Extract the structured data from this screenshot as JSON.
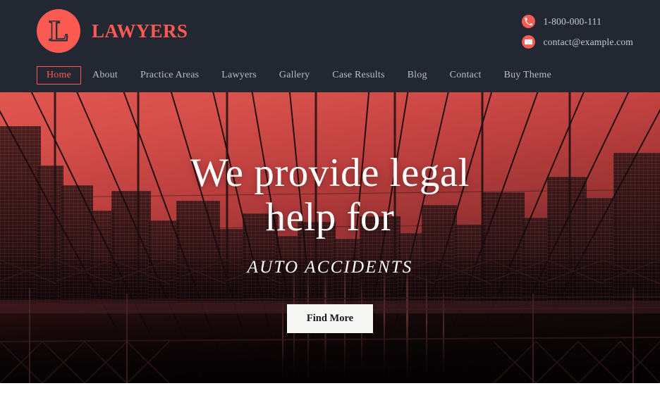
{
  "brand": {
    "logo_letter": "L",
    "name": "LAWYERS",
    "logo_icon": "lawyers-logo-circle",
    "accent_color": "#fb5b52",
    "header_bg": "#222732"
  },
  "contacts": [
    {
      "icon": "phone-icon",
      "text": "1-800-000-111"
    },
    {
      "icon": "envelope-icon",
      "text": "contact@example.com"
    }
  ],
  "nav": {
    "items": [
      {
        "label": "Home",
        "active": true
      },
      {
        "label": "About",
        "active": false
      },
      {
        "label": "Practice Areas",
        "active": false
      },
      {
        "label": "Lawyers",
        "active": false
      },
      {
        "label": "Gallery",
        "active": false
      },
      {
        "label": "Case Results",
        "active": false
      },
      {
        "label": "Blog",
        "active": false
      },
      {
        "label": "Contact",
        "active": false
      },
      {
        "label": "Buy Theme",
        "active": false
      }
    ]
  },
  "hero": {
    "title_line1": "We provide legal",
    "title_line2": "help for",
    "subtitle": "AUTO ACCIDENTS",
    "button_label": "Find More",
    "background_description": "red-tinted bridge and city skyline photograph"
  }
}
